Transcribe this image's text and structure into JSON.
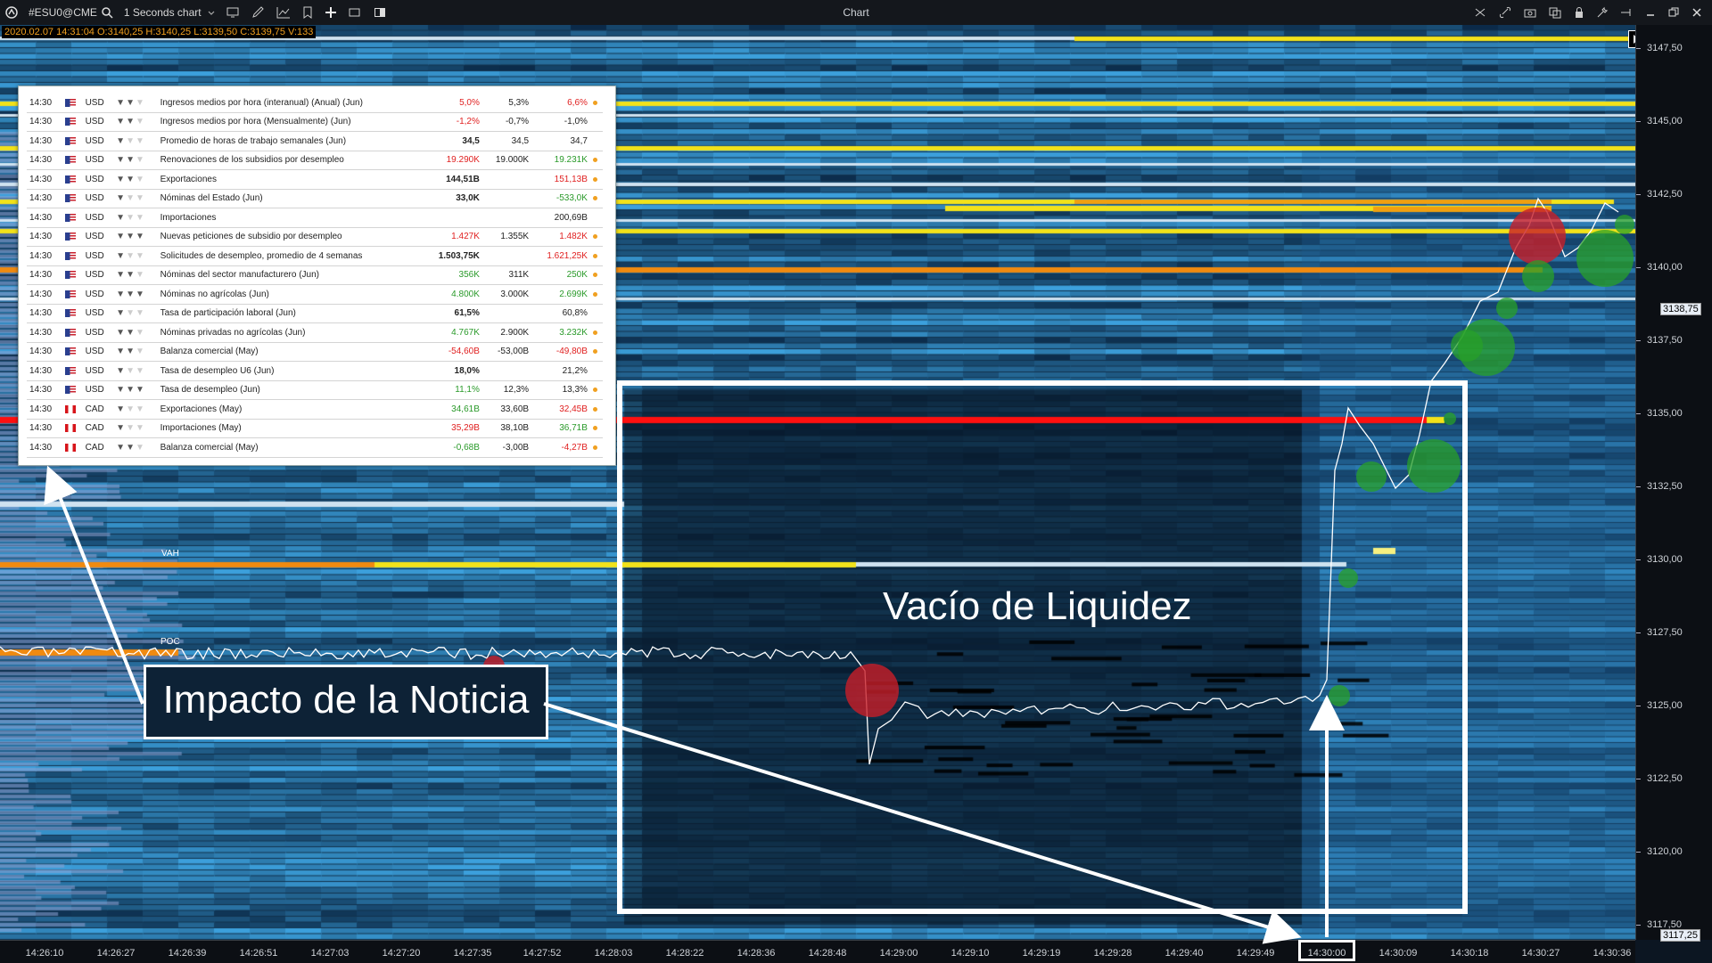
{
  "toolbar": {
    "symbol": "#ESU0@CME",
    "chart_type": "1 Seconds chart",
    "window_title": "Chart"
  },
  "ohlc_readout": "2020.02.07 14:31:04 O:3140,25 H:3140,25 L:3139,50 C:3139,75 V:133",
  "price_axis": {
    "ticks": [
      "3147,50",
      "3145,00",
      "3142,50",
      "3140,00",
      "3137,50",
      "3135,00",
      "3132,50",
      "3130,00",
      "3127,50",
      "3125,00",
      "3122,50",
      "3120,00",
      "3117,50"
    ],
    "current_price": "3138,75",
    "last_price": "3117,25"
  },
  "time_axis": {
    "ticks": [
      "14:26:10",
      "14:26:27",
      "14:26:39",
      "14:26:51",
      "14:27:03",
      "14:27:20",
      "14:27:35",
      "14:27:52",
      "14:28:03",
      "14:28:22",
      "14:28:36",
      "14:28:48",
      "14:29:00",
      "14:29:10",
      "14:29:19",
      "14:29:28",
      "14:29:40",
      "14:29:49",
      "14:30:00",
      "14:30:09",
      "14:30:18",
      "14:30:27",
      "14:30:36"
    ]
  },
  "levels": {
    "vah": "VAH",
    "poc": "POC"
  },
  "news": [
    {
      "time": "14:30",
      "cur": "USD",
      "flag": "us",
      "bulls": 2,
      "event": "Ingresos medios por hora (interanual) (Anual) (Jun)",
      "actual": "5,0%",
      "actual_color": "red",
      "forecast": "5,3%",
      "previous": "6,6%",
      "prev_color": "red",
      "dot": true
    },
    {
      "time": "14:30",
      "cur": "USD",
      "flag": "us",
      "bulls": 2,
      "event": "Ingresos medios por hora (Mensualmente) (Jun)",
      "actual": "-1,2%",
      "actual_color": "red",
      "forecast": "-0,7%",
      "previous": "-1,0%",
      "prev_color": "",
      "dot": false
    },
    {
      "time": "14:30",
      "cur": "USD",
      "flag": "us",
      "bulls": 1,
      "event": "Promedio de horas de trabajo semanales (Jun)",
      "actual": "34,5",
      "actual_color": "bold",
      "forecast": "34,5",
      "previous": "34,7",
      "prev_color": "",
      "dot": false
    },
    {
      "time": "14:30",
      "cur": "USD",
      "flag": "us",
      "bulls": 2,
      "event": "Renovaciones de los subsidios por desempleo",
      "actual": "19.290K",
      "actual_color": "red",
      "forecast": "19.000K",
      "previous": "19.231K",
      "prev_color": "green",
      "dot": true
    },
    {
      "time": "14:30",
      "cur": "USD",
      "flag": "us",
      "bulls": 2,
      "event": "Exportaciones",
      "actual": "144,51B",
      "actual_color": "bold",
      "forecast": "",
      "previous": "151,13B",
      "prev_color": "red",
      "dot": true
    },
    {
      "time": "14:30",
      "cur": "USD",
      "flag": "us",
      "bulls": 1,
      "event": "Nóminas del Estado (Jun)",
      "actual": "33,0K",
      "actual_color": "bold",
      "forecast": "",
      "previous": "-533,0K",
      "prev_color": "green",
      "dot": true
    },
    {
      "time": "14:30",
      "cur": "USD",
      "flag": "us",
      "bulls": 1,
      "event": "Importaciones",
      "actual": "",
      "actual_color": "",
      "forecast": "",
      "previous": "200,69B",
      "prev_color": "",
      "dot": false
    },
    {
      "time": "14:30",
      "cur": "USD",
      "flag": "us",
      "bulls": 3,
      "event": "Nuevas peticiones de subsidio por desempleo",
      "actual": "1.427K",
      "actual_color": "red",
      "forecast": "1.355K",
      "previous": "1.482K",
      "prev_color": "red",
      "dot": true
    },
    {
      "time": "14:30",
      "cur": "USD",
      "flag": "us",
      "bulls": 1,
      "event": "Solicitudes de desempleo, promedio de 4 semanas",
      "actual": "1.503,75K",
      "actual_color": "bold",
      "forecast": "",
      "previous": "1.621,25K",
      "prev_color": "red",
      "dot": true
    },
    {
      "time": "14:30",
      "cur": "USD",
      "flag": "us",
      "bulls": 2,
      "event": "Nóminas del sector manufacturero (Jun)",
      "actual": "356K",
      "actual_color": "green",
      "forecast": "311K",
      "previous": "250K",
      "prev_color": "green",
      "dot": true
    },
    {
      "time": "14:30",
      "cur": "USD",
      "flag": "us",
      "bulls": 3,
      "event": "Nóminas no agrícolas (Jun)",
      "actual": "4.800K",
      "actual_color": "green",
      "forecast": "3.000K",
      "previous": "2.699K",
      "prev_color": "green",
      "dot": true
    },
    {
      "time": "14:30",
      "cur": "USD",
      "flag": "us",
      "bulls": 1,
      "event": "Tasa de participación laboral (Jun)",
      "actual": "61,5%",
      "actual_color": "bold",
      "forecast": "",
      "previous": "60,8%",
      "prev_color": "",
      "dot": false
    },
    {
      "time": "14:30",
      "cur": "USD",
      "flag": "us",
      "bulls": 2,
      "event": "Nóminas privadas no agrícolas (Jun)",
      "actual": "4.767K",
      "actual_color": "green",
      "forecast": "2.900K",
      "previous": "3.232K",
      "prev_color": "green",
      "dot": true
    },
    {
      "time": "14:30",
      "cur": "USD",
      "flag": "us",
      "bulls": 2,
      "event": "Balanza comercial (May)",
      "actual": "-54,60B",
      "actual_color": "red",
      "forecast": "-53,00B",
      "previous": "-49,80B",
      "prev_color": "red",
      "dot": true
    },
    {
      "time": "14:30",
      "cur": "USD",
      "flag": "us",
      "bulls": 1,
      "event": "Tasa de desempleo U6 (Jun)",
      "actual": "18,0%",
      "actual_color": "bold",
      "forecast": "",
      "previous": "21,2%",
      "prev_color": "",
      "dot": false
    },
    {
      "time": "14:30",
      "cur": "USD",
      "flag": "us",
      "bulls": 3,
      "event": "Tasa de desempleo (Jun)",
      "actual": "11,1%",
      "actual_color": "green",
      "forecast": "12,3%",
      "previous": "13,3%",
      "prev_color": "",
      "dot": true
    },
    {
      "time": "14:30",
      "cur": "CAD",
      "flag": "ca",
      "bulls": 1,
      "event": "Exportaciones (May)",
      "actual": "34,61B",
      "actual_color": "green",
      "forecast": "33,60B",
      "previous": "32,45B",
      "prev_color": "red",
      "dot": true
    },
    {
      "time": "14:30",
      "cur": "CAD",
      "flag": "ca",
      "bulls": 1,
      "event": "Importaciones (May)",
      "actual": "35,29B",
      "actual_color": "red",
      "forecast": "38,10B",
      "previous": "36,71B",
      "prev_color": "green",
      "dot": true
    },
    {
      "time": "14:30",
      "cur": "CAD",
      "flag": "ca",
      "bulls": 2,
      "event": "Balanza comercial (May)",
      "actual": "-0,68B",
      "actual_color": "green",
      "forecast": "-3,00B",
      "previous": "-4,27B",
      "prev_color": "red",
      "dot": true
    }
  ],
  "annotations": {
    "impact": "Impacto de la Noticia",
    "liquidity_gap": "Vacío de Liquidez"
  },
  "colors": {
    "heat_low": "#0b1e31",
    "heat_mid": "#1f6ea8",
    "heat_high": "#3a9ad6",
    "level_yellow": "#f2e21a",
    "level_orange": "#f08a10",
    "level_red": "#ff1010",
    "bubble_green": "#2aa02a",
    "bubble_red": "#c02020"
  }
}
